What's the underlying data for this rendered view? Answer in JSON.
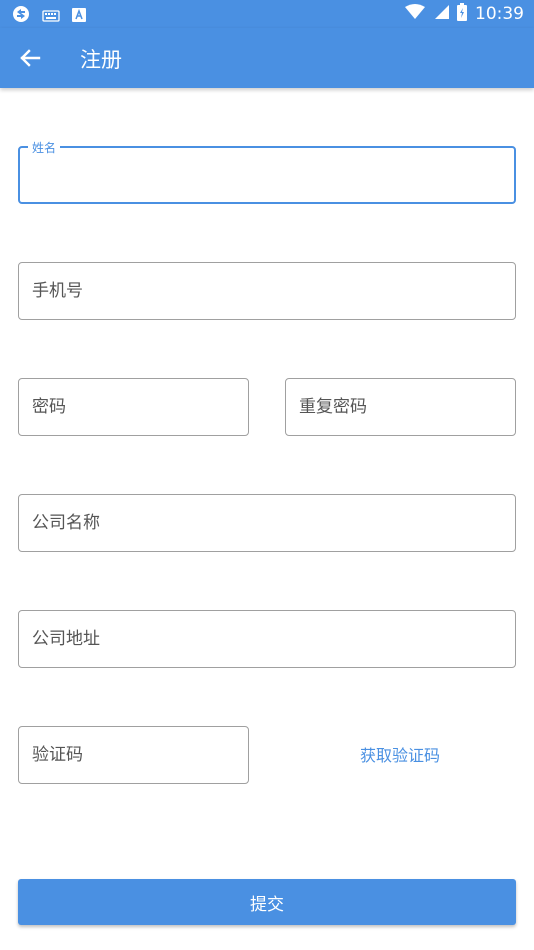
{
  "status_bar": {
    "time": "10:39",
    "left_icons": [
      "sync-icon",
      "keyboard-icon",
      "a-icon"
    ],
    "right_icons": [
      "wifi-icon",
      "signal-icon",
      "battery-icon"
    ]
  },
  "toolbar": {
    "title": "注册",
    "back_icon": "arrow-left-icon"
  },
  "form": {
    "name_label": "姓名",
    "name_value": "",
    "phone_placeholder": "手机号",
    "password_placeholder": "密码",
    "repeat_password_placeholder": "重复密码",
    "company_name_placeholder": "公司名称",
    "company_address_placeholder": "公司地址",
    "verification_code_placeholder": "验证码",
    "get_code_label": "获取验证码",
    "submit_label": "提交"
  },
  "colors": {
    "primary": "#4a90e2",
    "border": "#a0a0a0",
    "background": "#ffffff"
  }
}
